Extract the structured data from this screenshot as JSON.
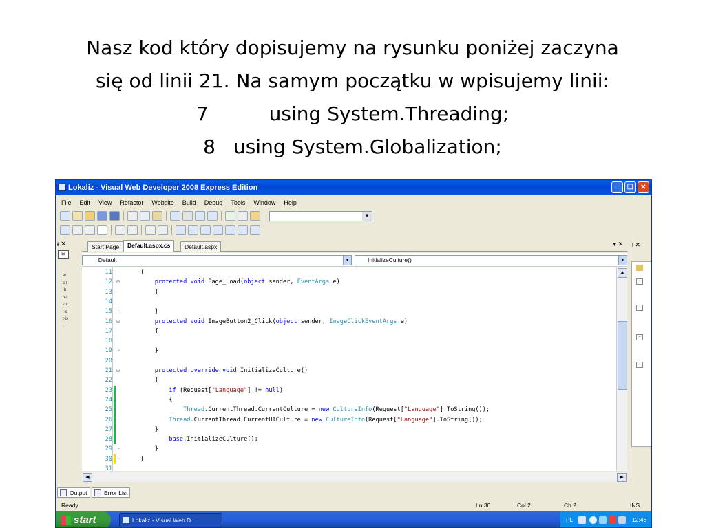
{
  "slide": {
    "line1": "Nasz kod który dopisujemy na rysunku poniżej zaczyna",
    "line2": "się od linii 21. Na samym początku w wpisujemy linii:",
    "line3_num": "7",
    "line3_text": "using System.Threading;",
    "line4_num": "8",
    "line4_text": "using System.Globalization;"
  },
  "window": {
    "title": "Lokaliz - Visual Web Developer 2008 Express Edition",
    "controls": [
      "_",
      "❐",
      "✕"
    ]
  },
  "menu": [
    "File",
    "Edit",
    "View",
    "Refactor",
    "Website",
    "Build",
    "Debug",
    "Tools",
    "Window",
    "Help"
  ],
  "doc_tabs": {
    "items": [
      "Start Page",
      "Default.aspx.cs",
      "Default.aspx"
    ],
    "active_index": 1,
    "controls": "▾ ✕"
  },
  "left_panel": {
    "header": "ᵻ ✕",
    "button": "⊟",
    "vertical_text": "erc·l·bn·iɛ·ɛr·ɛt·iɔ·"
  },
  "right_panel": {
    "header": "ᵻ ✕"
  },
  "navbar": {
    "class_combo": "_Default",
    "member_combo": "InitializeCulture()"
  },
  "code": {
    "lines": [
      {
        "n": "11",
        "fold": "",
        "chg": "",
        "tokens": [
          [
            "p",
            "{"
          ]
        ]
      },
      {
        "n": "12",
        "fold": "⊟",
        "chg": "",
        "tokens": [
          [
            "p",
            "    "
          ],
          [
            "k",
            "protected void "
          ],
          [
            "p",
            "Page_Load("
          ],
          [
            "k",
            "object "
          ],
          [
            "p",
            "sender, "
          ],
          [
            "t",
            "EventArgs "
          ],
          [
            "p",
            "e)"
          ]
        ]
      },
      {
        "n": "13",
        "fold": "",
        "chg": "",
        "tokens": [
          [
            "p",
            "    {"
          ]
        ]
      },
      {
        "n": "14",
        "fold": "",
        "chg": "",
        "tokens": [
          [
            "p",
            ""
          ]
        ]
      },
      {
        "n": "15",
        "fold": "└",
        "chg": "",
        "tokens": [
          [
            "p",
            "    }"
          ]
        ]
      },
      {
        "n": "16",
        "fold": "⊟",
        "chg": "",
        "tokens": [
          [
            "p",
            "    "
          ],
          [
            "k",
            "protected void "
          ],
          [
            "p",
            "ImageButton2_Click("
          ],
          [
            "k",
            "object "
          ],
          [
            "p",
            "sender, "
          ],
          [
            "t",
            "ImageClickEventArgs "
          ],
          [
            "p",
            "e)"
          ]
        ]
      },
      {
        "n": "17",
        "fold": "",
        "chg": "",
        "tokens": [
          [
            "p",
            "    {"
          ]
        ]
      },
      {
        "n": "18",
        "fold": "",
        "chg": "",
        "tokens": [
          [
            "p",
            ""
          ]
        ]
      },
      {
        "n": "19",
        "fold": "└",
        "chg": "",
        "tokens": [
          [
            "p",
            "    }"
          ]
        ]
      },
      {
        "n": "20",
        "fold": "",
        "chg": "",
        "tokens": [
          [
            "p",
            ""
          ]
        ]
      },
      {
        "n": "21",
        "fold": "⊟",
        "chg": "",
        "tokens": [
          [
            "p",
            "    "
          ],
          [
            "k",
            "protected override void "
          ],
          [
            "p",
            "InitializeCulture()"
          ]
        ]
      },
      {
        "n": "22",
        "fold": "",
        "chg": "",
        "tokens": [
          [
            "p",
            "    {"
          ]
        ]
      },
      {
        "n": "23",
        "fold": "",
        "chg": "g",
        "tokens": [
          [
            "p",
            "        "
          ],
          [
            "k",
            "if "
          ],
          [
            "p",
            "(Request["
          ],
          [
            "s",
            "\"Language\""
          ],
          [
            "p",
            "] != "
          ],
          [
            "k",
            "null"
          ],
          [
            "p",
            ")"
          ]
        ]
      },
      {
        "n": "24",
        "fold": "",
        "chg": "g",
        "tokens": [
          [
            "p",
            "        {"
          ]
        ]
      },
      {
        "n": "25",
        "fold": "",
        "chg": "g",
        "tokens": [
          [
            "p",
            "            "
          ],
          [
            "t",
            "Thread"
          ],
          [
            "p",
            ".CurrentThread.CurrentCulture = "
          ],
          [
            "k",
            "new "
          ],
          [
            "t",
            "CultureInfo"
          ],
          [
            "p",
            "(Request["
          ],
          [
            "s",
            "\"Language\""
          ],
          [
            "p",
            "].ToString());"
          ]
        ]
      },
      {
        "n": "26",
        "fold": "",
        "chg": "g",
        "tokens": [
          [
            "p",
            "        "
          ],
          [
            "t",
            "Thread"
          ],
          [
            "p",
            ".CurrentThread.CurrentUICulture = "
          ],
          [
            "k",
            "new "
          ],
          [
            "t",
            "CultureInfo"
          ],
          [
            "p",
            "(Request["
          ],
          [
            "s",
            "\"Language\""
          ],
          [
            "p",
            "].ToString());"
          ]
        ]
      },
      {
        "n": "27",
        "fold": "",
        "chg": "g",
        "tokens": [
          [
            "p",
            "    }"
          ]
        ]
      },
      {
        "n": "28",
        "fold": "",
        "chg": "g",
        "tokens": [
          [
            "p",
            "        "
          ],
          [
            "k",
            "base"
          ],
          [
            "p",
            ".InitializeCulture();"
          ]
        ]
      },
      {
        "n": "29",
        "fold": "└",
        "chg": "",
        "tokens": [
          [
            "p",
            "    }"
          ]
        ]
      },
      {
        "n": "30",
        "fold": "└",
        "chg": "y",
        "tokens": [
          [
            "p",
            "}"
          ]
        ]
      },
      {
        "n": "31",
        "fold": "",
        "chg": "",
        "tokens": [
          [
            "p",
            ""
          ]
        ]
      }
    ],
    "colors": {
      "keyword": "#0000ff",
      "type": "#2b91af",
      "string": "#a31515",
      "changed": "#22b14c",
      "unsaved": "#ffd800"
    }
  },
  "bottom_tabs": [
    "Output",
    "Error List"
  ],
  "status": {
    "ready": "Ready",
    "ln": "Ln 30",
    "col": "Col 2",
    "ch": "Ch 2",
    "mode": "INS"
  },
  "taskbar": {
    "start": "start",
    "task": "Lokaliz - Visual Web D...",
    "lang": "PL",
    "time": "12:46"
  }
}
